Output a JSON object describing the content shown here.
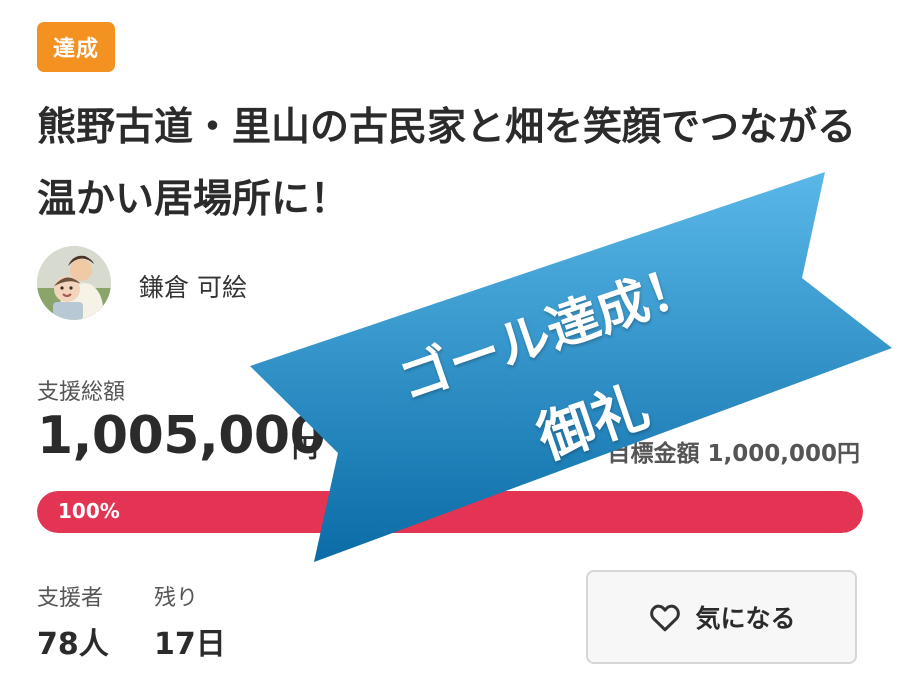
{
  "project": {
    "status": "達成",
    "title": "熊野古道・里山の古民家と畑を笑顔でつながる温かい居場所に！",
    "owner_name": "鎌倉 可絵"
  },
  "funding": {
    "total_label": "支援総額",
    "total_amount": "1,005,000",
    "currency_unit": "円",
    "goal_label": "目標金額",
    "goal_amount": "1,000,000円",
    "progress_text": "100%",
    "progress_value": 100
  },
  "stats": {
    "supporters_label": "支援者",
    "supporters_value": "78人",
    "remaining_label": "残り",
    "remaining_value": "17日"
  },
  "actions": {
    "favorite_label": "気になる"
  },
  "banner": {
    "line1": "ゴール達成！",
    "line2": "御礼",
    "colors": {
      "top": "#5ab8e8",
      "bottom": "#0a6ba6"
    }
  },
  "colors": {
    "badge": "#f39121",
    "progress": "#e33553"
  },
  "icons": {
    "favorite": "heart-outline-icon"
  }
}
